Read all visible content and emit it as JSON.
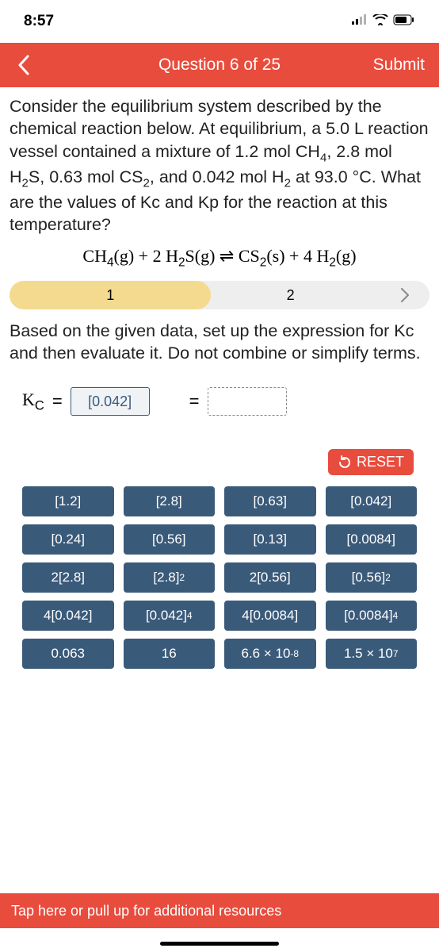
{
  "status": {
    "time": "8:57"
  },
  "header": {
    "title": "Question 6 of 25",
    "submit": "Submit"
  },
  "question": {
    "text_html": "Consider the equilibrium system described by the chemical reaction below. At equilibrium, a 5.0 L reaction vessel contained a mixture of 1.2 mol CH<span class='sub-small'>4</span>, 2.8 mol H<span class='sub-small'>2</span>S, 0.63 mol CS<span class='sub-small'>2</span>, and 0.042 mol H<span class='sub-small'>2</span> at 93.0 °C. What are the values of Kc and Kp for the reaction at this temperature?",
    "equation_html": "CH<span class='sub-small'>4</span>(g) + 2 H<span class='sub-small'>2</span>S(g) ⇌ CS<span class='sub-small'>2</span>(s) + 4 H<span class='sub-small'>2</span>(g)"
  },
  "steps": {
    "step1": "1",
    "step2": "2"
  },
  "subprompt": "Based on the given data, set up the expression for Kc and then evaluate it. Do not combine or simplify terms.",
  "kc": {
    "label_html": "K<span class='kc-sub'>C</span>",
    "eq": "=",
    "slot1": "[0.042]",
    "eq2": "="
  },
  "reset": "RESET",
  "tiles": [
    {
      "html": "[1.2]"
    },
    {
      "html": "[2.8]"
    },
    {
      "html": "[0.63]"
    },
    {
      "html": "[0.042]"
    },
    {
      "html": "[0.24]"
    },
    {
      "html": "[0.56]"
    },
    {
      "html": "[0.13]"
    },
    {
      "html": "[0.0084]"
    },
    {
      "html": "2[2.8]"
    },
    {
      "html": "[2.8]<span class='sup-small'>2</span>"
    },
    {
      "html": "2[0.56]"
    },
    {
      "html": "[0.56]<span class='sup-small'>2</span>"
    },
    {
      "html": "4[0.042]"
    },
    {
      "html": "[0.042]<span class='sup-small'>4</span>"
    },
    {
      "html": "4[0.0084]"
    },
    {
      "html": "[0.0084]<span class='sup-small'>4</span>"
    },
    {
      "html": "0.063"
    },
    {
      "html": "16"
    },
    {
      "html": "6.6 × 10<span class='sup-small'>-8</span>"
    },
    {
      "html": "1.5 × 10<span class='sup-small'>7</span>"
    }
  ],
  "footer": "Tap here or pull up for additional resources"
}
